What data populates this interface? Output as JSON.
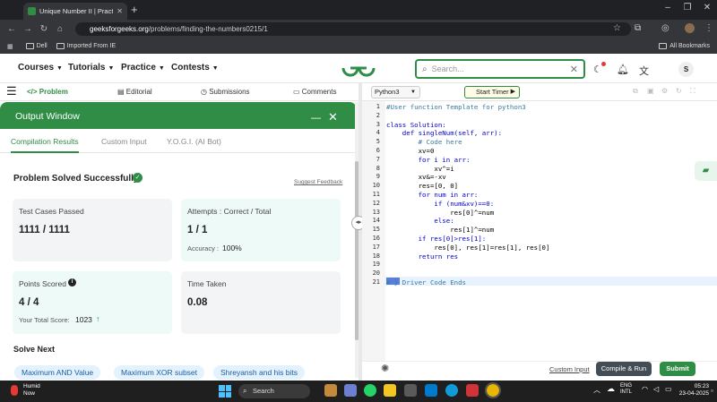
{
  "browser": {
    "tab_title": "Unique Number II | Practice | G",
    "url_domain": "geeksforgeeks.org",
    "url_path": "/problems/finding-the-numbers0215/1",
    "bookmarks": [
      "Dell",
      "Imported From IE"
    ],
    "all_bookmarks": "All Bookmarks"
  },
  "header": {
    "menus": [
      "Courses",
      "Tutorials",
      "Practice",
      "Contests"
    ],
    "search_placeholder": "Search...",
    "avatar_letter": "S"
  },
  "problem_tabs": [
    "Problem",
    "Editorial",
    "Submissions",
    "Comments"
  ],
  "output": {
    "title": "Output Window",
    "tabs": [
      "Compilation Results",
      "Custom Input",
      "Y.O.G.I. (AI Bot)"
    ],
    "status": "Problem Solved Successfully",
    "feedback": "Suggest Feedback",
    "cards": {
      "tests_label": "Test Cases Passed",
      "tests_value": "1111 / 1111",
      "attempts_label": "Attempts : Correct / Total",
      "attempts_value": "1 / 1",
      "accuracy_label": "Accuracy :",
      "accuracy_value": "100%",
      "points_label": "Points Scored",
      "points_value": "4 / 4",
      "total_label": "Your Total Score:",
      "total_value": "1023",
      "time_label": "Time Taken",
      "time_value": "0.08"
    },
    "solve_next_title": "Solve Next",
    "solve_next": [
      "Maximum AND Value",
      "Maximum XOR subset",
      "Shreyansh and his bits"
    ]
  },
  "editor": {
    "language": "Python3",
    "timer": "Start Timer",
    "custom_input": "Custom Input",
    "compile": "Compile & Run",
    "submit": "Submit"
  },
  "code_lines": [
    "#User function Template for python3",
    "",
    "class Solution:",
    "    def singleNum(self, arr):",
    "        # Code here",
    "        xv=0",
    "        for i in arr:",
    "            xv^=i",
    "        xv&=-xv",
    "        res=[0, 0]",
    "        for num in arr:",
    "            if (num&xv)==0:",
    "                res[0]^=num",
    "            else:",
    "                res[1]^=num",
    "        if res[0]>res[1]:",
    "            res[0], res[1]=res[1], res[0]",
    "        return res",
    "",
    "",
    "# } Driver Code Ends"
  ],
  "taskbar": {
    "weather_title": "Humid",
    "weather_sub": "Now",
    "search": "Search",
    "lang_1": "ENG",
    "lang_2": "INTL",
    "time": "05:23",
    "date": "23-04-2025"
  }
}
